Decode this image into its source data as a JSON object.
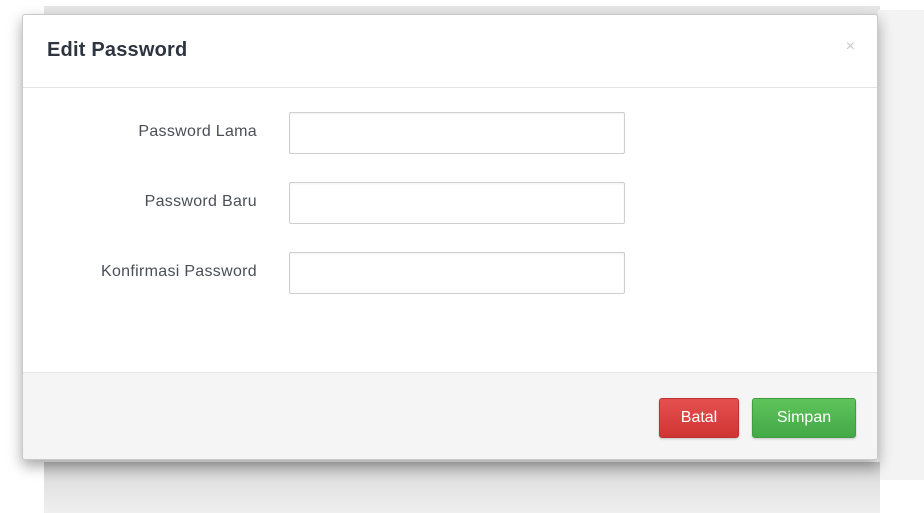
{
  "dialog": {
    "title": "Edit Password",
    "close_glyph": "×"
  },
  "form": {
    "fields": [
      {
        "label": "Password Lama",
        "value": "",
        "placeholder": ""
      },
      {
        "label": "Password Baru",
        "value": "",
        "placeholder": ""
      },
      {
        "label": "Konfirmasi Password",
        "value": "",
        "placeholder": ""
      }
    ]
  },
  "footer": {
    "cancel_label": "Batal",
    "save_label": "Simpan"
  },
  "colors": {
    "cancel": "#d9423f",
    "save": "#4cb64e",
    "title_text": "#2f3540"
  },
  "icons": {
    "close": "close-icon"
  }
}
